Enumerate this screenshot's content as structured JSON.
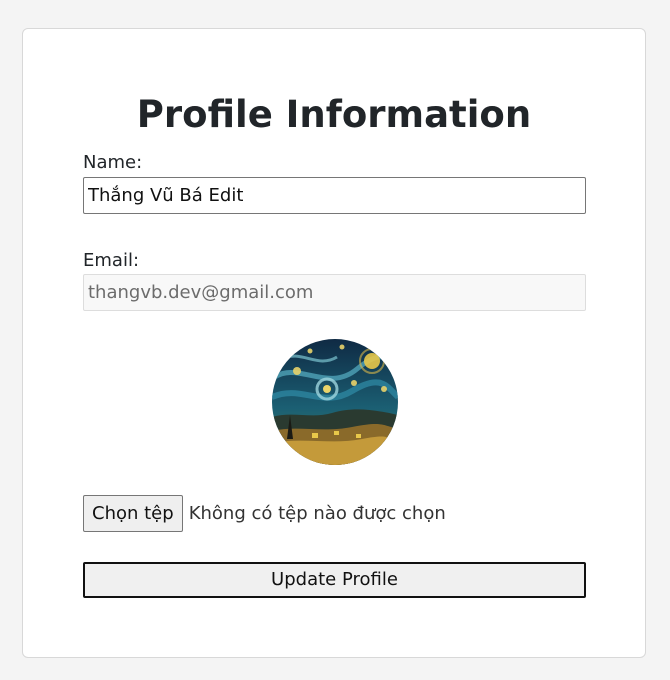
{
  "form": {
    "title": "Profile Information",
    "name_label": "Name:",
    "name_value": "Thắng Vũ Bá Edit",
    "email_label": "Email:",
    "email_value": "thangvb.dev@gmail.com",
    "file_button_label": "Chọn tệp",
    "file_status": "Không có tệp nào được chọn",
    "submit_label": "Update Profile"
  },
  "colors": {
    "page_background": "#f4f4f4",
    "card_background": "#ffffff",
    "title_text": "#212529",
    "disabled_field_background": "#f8f8f8"
  }
}
